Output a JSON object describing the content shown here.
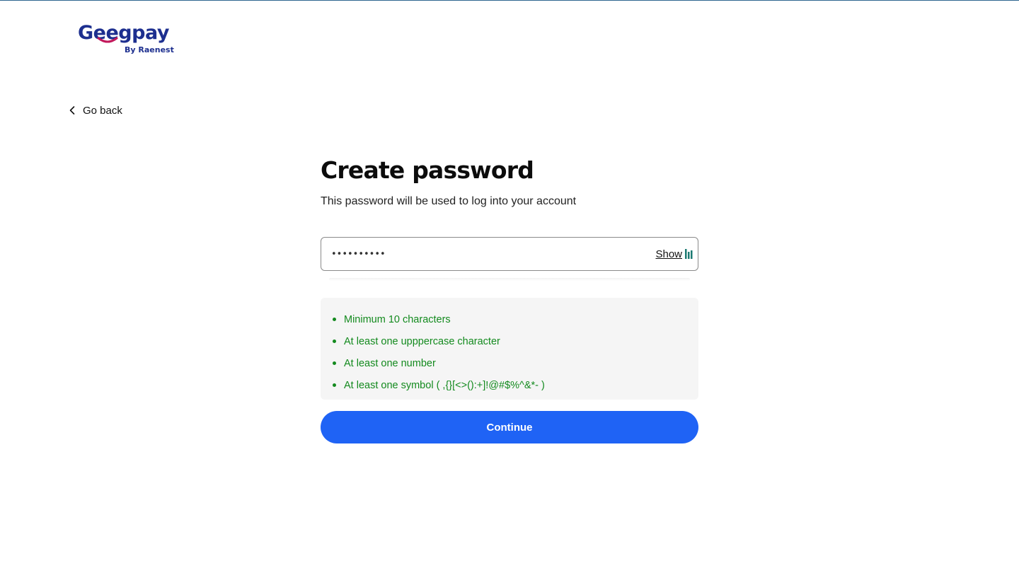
{
  "brand": {
    "logo_text": "Geegpay",
    "logo_subtext": "By Raenest",
    "logo_color": "#1d2f8f",
    "smile_color": "#c2185b"
  },
  "nav": {
    "back_label": "Go back",
    "back_icon": "chevron-left-icon"
  },
  "form": {
    "title": "Create password",
    "subtitle": "This password will be used to log into your account",
    "password": {
      "value": "••••••••••",
      "show_label": "Show",
      "manager_icon": "password-manager-icon"
    },
    "requirements": [
      "Minimum 10 characters",
      "At least one upppercase character",
      "At least one number",
      "At least one symbol ( ,{}[<>():+]!@#$%^&*- )"
    ],
    "requirement_color": "#138a1e",
    "submit_label": "Continue",
    "accent_color": "#1f63f5"
  }
}
